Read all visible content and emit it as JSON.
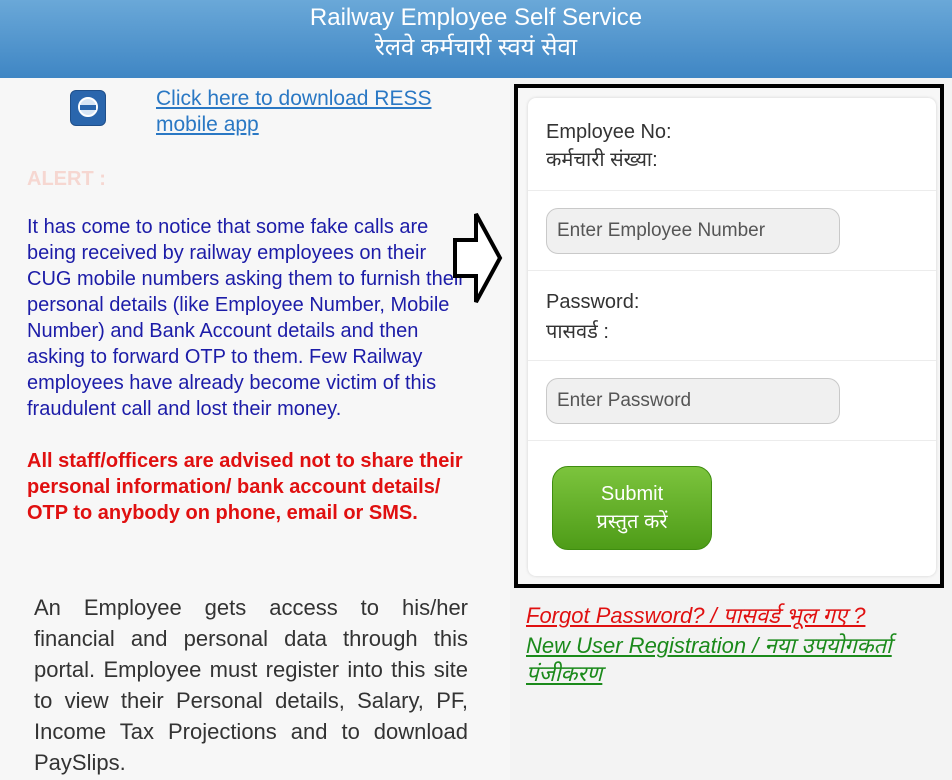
{
  "header": {
    "title_en": "Railway Employee Self Service",
    "title_hi": "रेलवे कर्मचारी स्वयं सेवा"
  },
  "left": {
    "download_link": "Click here to download RESS mobile app",
    "app_icon": "ress-app-icon",
    "alert_label": "ALERT :",
    "alert_text": "It has come to notice that some fake calls are being received by railway employees on their CUG mobile numbers asking them to furnish their personal details (like Employee Number, Mobile Number) and Bank Account details and then asking to forward OTP to them. Few Railway employees have already become victim of this fraudulent call and lost their money.",
    "alert_warning": "All staff/officers are advised not to share their personal information/ bank account details/ OTP to anybody on phone, email or SMS.",
    "about_text": "An Employee gets access to his/her financial and personal data through this portal. Employee must register into this site to view their Personal details, Salary, PF, Income Tax Projections and to download PaySlips."
  },
  "login": {
    "employee_label_en": "Employee No:",
    "employee_label_hi": "कर्मचारी संख्या:",
    "employee_placeholder": "Enter Employee Number",
    "employee_value": "",
    "password_label_en": "Password:",
    "password_label_hi": "पासवर्ड :",
    "password_placeholder": "Enter Password",
    "password_value": "",
    "submit_en": "Submit",
    "submit_hi": "प्रस्तुत करें"
  },
  "links": {
    "forgot_password": "Forgot Password? / पासवर्ड भूल गए ?",
    "new_user_registration": "New User Registration / नया उपयोगकर्ता पंजीकरण"
  },
  "colors": {
    "header_blue": "#3f86c4",
    "alert_blue": "#1c1ca8",
    "alert_red": "#e01010",
    "submit_green": "#5aa820",
    "register_green": "#1b8a1b"
  },
  "icons": {
    "arrow": "arrow-right-outline-icon"
  }
}
